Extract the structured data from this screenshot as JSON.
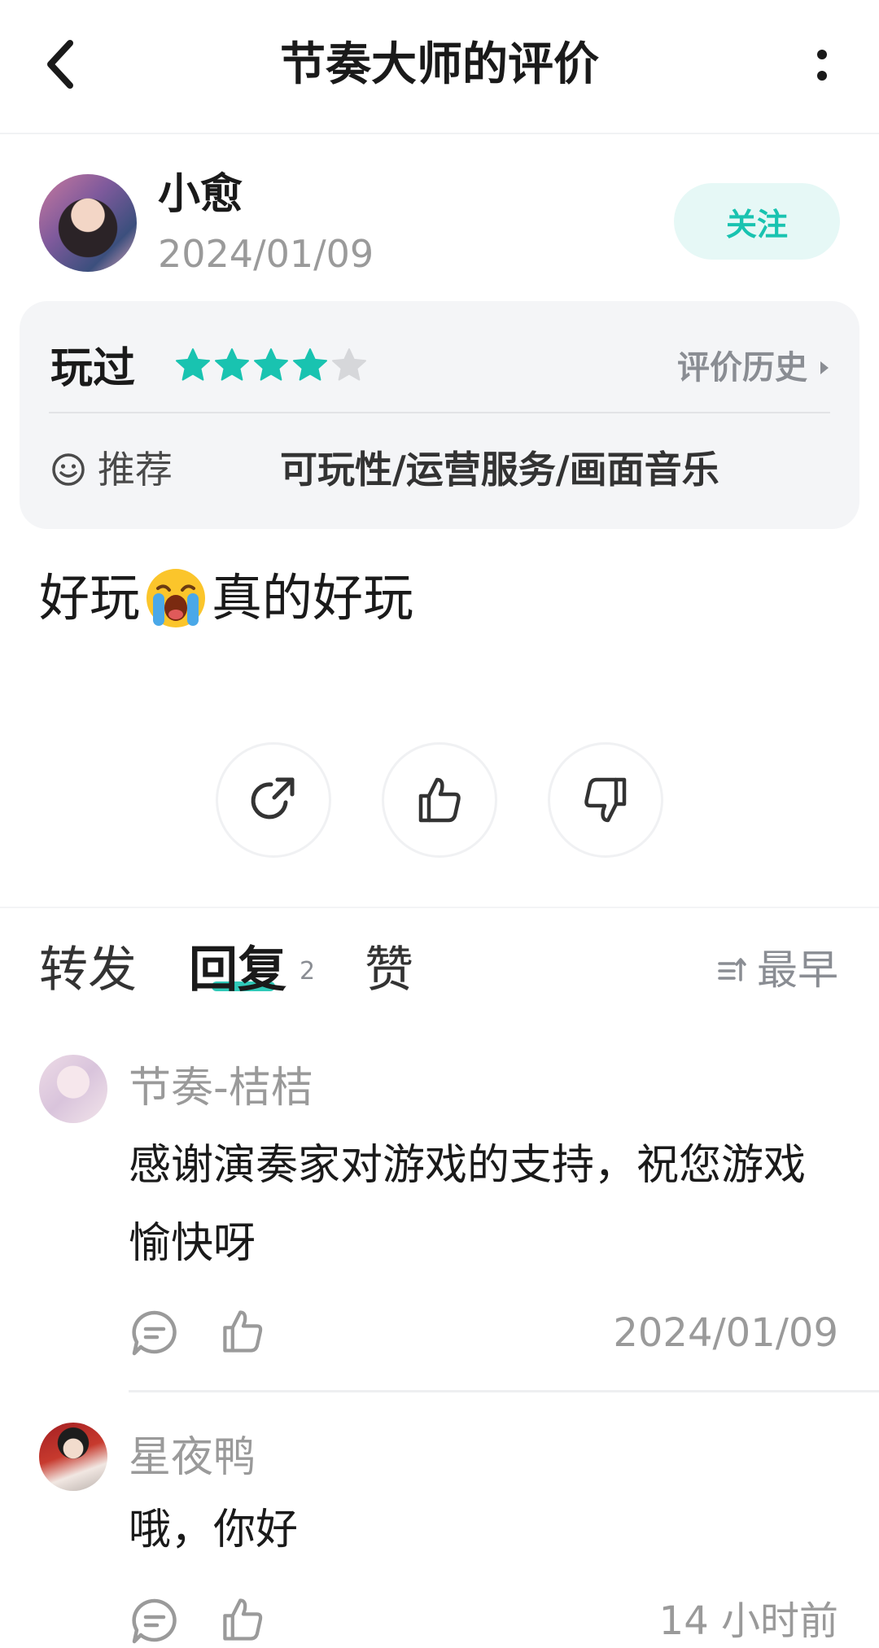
{
  "header": {
    "title": "节奏大师的评价",
    "back_icon": "chevron-left-icon",
    "more_icon": "more-vertical-icon"
  },
  "author": {
    "name": "小愈",
    "date": "2024/01/09",
    "follow_label": "关注"
  },
  "rating": {
    "status_label": "玩过",
    "stars": 4,
    "max_stars": 5,
    "history_label": "评价历史",
    "recommend_label": "推荐",
    "tags": "可玩性/运营服务/画面音乐"
  },
  "review": {
    "text_before": "好玩",
    "emoji": "loudly-crying-face",
    "text_after": "真的好玩"
  },
  "actions": {
    "share_icon": "share-icon",
    "like_icon": "thumbs-up-icon",
    "dislike_icon": "thumbs-down-icon"
  },
  "tabs": {
    "repost": "转发",
    "reply": "回复",
    "reply_count": "2",
    "likes": "赞",
    "sort_label": "最早"
  },
  "comments": [
    {
      "name": "节奏-桔桔",
      "text": "感谢演奏家对游戏的支持，祝您游戏愉快呀",
      "time": "2024/01/09"
    },
    {
      "name": "星夜鸭",
      "text": "哦，你好",
      "time": "14 小时前"
    }
  ],
  "colors": {
    "accent": "#19c3b0",
    "follow_bg": "#e6f8f6",
    "card_bg": "#f4f5f7",
    "star_empty": "#d6d7da"
  }
}
